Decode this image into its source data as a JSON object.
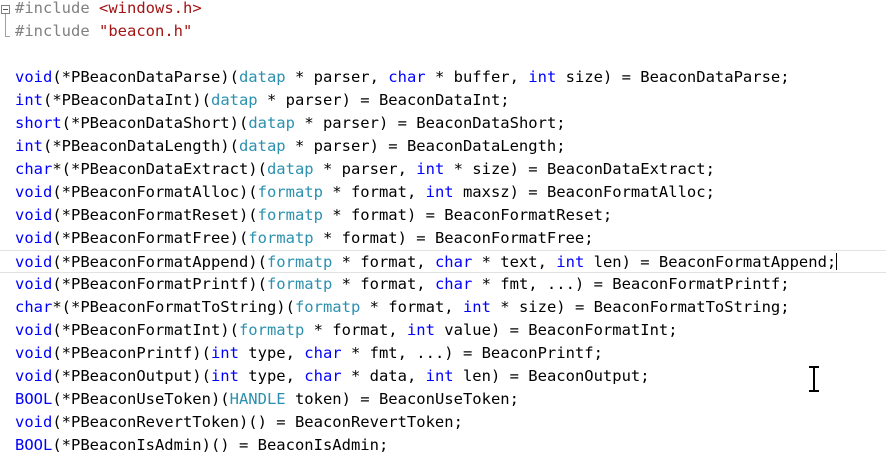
{
  "editor": {
    "include_lines": [
      {
        "directive": "#include",
        "sp": " ",
        "header": "<windows.h>"
      },
      {
        "directive": "#include",
        "sp": " ",
        "header": "\"beacon.h\""
      }
    ],
    "code_lines": [
      {
        "t": "void",
        "a": "(*PBeaconDataParse)(",
        "b": "datap",
        "c": " * parser, ",
        "d": "char",
        "e": " * buffer, ",
        "f": "int",
        "g": " size) = BeaconDataParse;"
      },
      {
        "t": "int",
        "a": "(*PBeaconDataInt)(",
        "b": "datap",
        "c": " * parser) = BeaconDataInt;",
        "d": "",
        "e": "",
        "f": "",
        "g": ""
      },
      {
        "t": "short",
        "a": "(*PBeaconDataShort)(",
        "b": "datap",
        "c": " * parser) = BeaconDataShort;",
        "d": "",
        "e": "",
        "f": "",
        "g": ""
      },
      {
        "t": "int",
        "a": "(*PBeaconDataLength)(",
        "b": "datap",
        "c": " * parser) = BeaconDataLength;",
        "d": "",
        "e": "",
        "f": "",
        "g": ""
      },
      {
        "t": "char",
        "a": "*(*PBeaconDataExtract)(",
        "b": "datap",
        "c": " * parser, ",
        "d": "int",
        "e": " * size) = BeaconDataExtract;",
        "f": "",
        "g": ""
      },
      {
        "t": "void",
        "a": "(*PBeaconFormatAlloc)(",
        "b": "formatp",
        "c": " * format, ",
        "d": "int",
        "e": " maxsz) = BeaconFormatAlloc;",
        "f": "",
        "g": ""
      },
      {
        "t": "void",
        "a": "(*PBeaconFormatReset)(",
        "b": "formatp",
        "c": " * format) = BeaconFormatReset;",
        "d": "",
        "e": "",
        "f": "",
        "g": ""
      },
      {
        "t": "void",
        "a": "(*PBeaconFormatFree)(",
        "b": "formatp",
        "c": " * format) = BeaconFormatFree;",
        "d": "",
        "e": "",
        "f": "",
        "g": ""
      },
      {
        "t": "void",
        "a": "(*PBeaconFormatAppend)(",
        "b": "formatp",
        "c": " * format, ",
        "d": "char",
        "e": " * text, ",
        "f": "int",
        "g": " len) = BeaconFormatAppend;"
      },
      {
        "t": "void",
        "a": "(*PBeaconFormatPrintf)(",
        "b": "formatp",
        "c": " * format, ",
        "d": "char",
        "e": " * fmt, ...) = BeaconFormatPrintf;",
        "f": "",
        "g": ""
      },
      {
        "t": "char",
        "a": "*(*PBeaconFormatToString)(",
        "b": "formatp",
        "c": " * format, ",
        "d": "int",
        "e": " * size) = BeaconFormatToString;",
        "f": "",
        "g": ""
      },
      {
        "t": "void",
        "a": "(*PBeaconFormatInt)(",
        "b": "formatp",
        "c": " * format, ",
        "d": "int",
        "e": " value) = BeaconFormatInt;",
        "f": "",
        "g": ""
      },
      {
        "t": "void",
        "a": "(*PBeaconPrintf)(",
        "b": "int",
        "c": " type, ",
        "d": "char",
        "e": " * fmt, ...) = BeaconPrintf;",
        "f": "",
        "g": ""
      },
      {
        "t": "void",
        "a": "(*PBeaconOutput)(",
        "b": "int",
        "c": " type, ",
        "d": "char",
        "e": " * data, ",
        "f": "int",
        "g": " len) = BeaconOutput;"
      },
      {
        "t": "BOOL",
        "a": "(*PBeaconUseToken)(",
        "b": "HANDLE",
        "c": " token) = BeaconUseToken;",
        "d": "",
        "e": "",
        "f": "",
        "g": ""
      },
      {
        "t": "void",
        "a": "(*PBeaconRevertToken)() = BeaconRevertToken;",
        "b": "",
        "c": "",
        "d": "",
        "e": "",
        "f": "",
        "g": ""
      },
      {
        "t": "BOOL",
        "a": "(*PBeaconIsAdmin)() = BeaconIsAdmin;",
        "b": "",
        "c": "",
        "d": "",
        "e": "",
        "f": "",
        "g": ""
      }
    ],
    "colors": {
      "keyword": "#0000ff",
      "type": "#2b91af",
      "preprocessor": "#808080",
      "string": "#a31515"
    },
    "current_line": 8,
    "icons": {
      "fold": "fold-minus-icon",
      "cursor": "i-beam-cursor-icon"
    }
  }
}
